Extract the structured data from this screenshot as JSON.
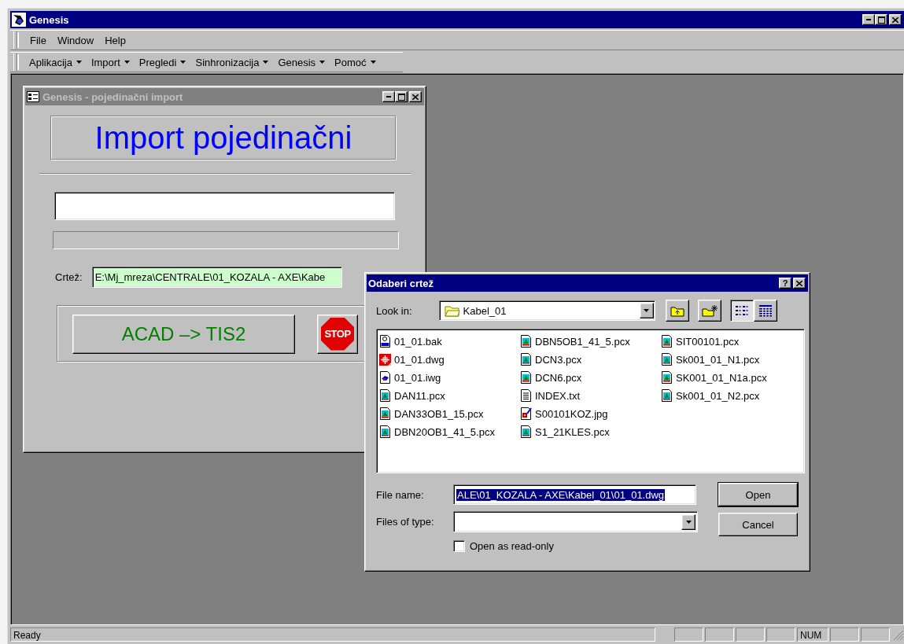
{
  "window": {
    "title": "Genesis",
    "active": true
  },
  "menu": [
    {
      "label": "File"
    },
    {
      "label": "Window"
    },
    {
      "label": "Help"
    }
  ],
  "toolbar": [
    {
      "label": "Aplikacija"
    },
    {
      "label": "Import"
    },
    {
      "label": "Pregledi"
    },
    {
      "label": "Sinhronizacija"
    },
    {
      "label": "Genesis"
    },
    {
      "label": "Pomoć"
    }
  ],
  "import_window": {
    "title": "Genesis - pojedinačni import",
    "active": false,
    "heading": "Import pojedinačni",
    "progress": {
      "level": 0
    },
    "drawing_label": "Crtež:",
    "drawing_path": "E:\\Mj_mreza\\CENTRALE\\01_KOZALA - AXE\\Kabe",
    "convert_button": "ACAD –> TIS2",
    "stop_button": "STOP"
  },
  "dialog": {
    "title": "Odaberi crtež",
    "active": true,
    "help_button": "?",
    "look_in_label": "Look in:",
    "folder": "Kabel_01",
    "view_buttons": [
      {
        "kind": "list",
        "selected": true
      },
      {
        "kind": "details",
        "selected": false
      }
    ],
    "files": [
      {
        "name": "01_01.bak",
        "kind": "bak"
      },
      {
        "name": "01_01.dwg",
        "kind": "dwg"
      },
      {
        "name": "01_01.iwg",
        "kind": "iwg"
      },
      {
        "name": "DAN11.pcx",
        "kind": "pcx"
      },
      {
        "name": "DAN33OB1_15.pcx",
        "kind": "pcx"
      },
      {
        "name": "DBN20OB1_41_5.pcx",
        "kind": "pcx"
      },
      {
        "name": "DBN5OB1_41_5.pcx",
        "kind": "pcx"
      },
      {
        "name": "DCN3.pcx",
        "kind": "pcx"
      },
      {
        "name": "DCN6.pcx",
        "kind": "pcx"
      },
      {
        "name": "INDEX.txt",
        "kind": "txt"
      },
      {
        "name": "S00101KOZ.jpg",
        "kind": "jpg"
      },
      {
        "name": "S1_21KLES.pcx",
        "kind": "pcx"
      },
      {
        "name": "SIT00101.pcx",
        "kind": "pcx"
      },
      {
        "name": "Sk001_01_N1.pcx",
        "kind": "pcx"
      },
      {
        "name": "SK001_01_N1a.pcx",
        "kind": "pcx"
      },
      {
        "name": "Sk001_01_N2.pcx",
        "kind": "pcx"
      }
    ],
    "file_name_label": "File name:",
    "file_name": "ALE\\01_KOZALA - AXE\\Kabel_01\\01_01.dwg",
    "file_name_selected": true,
    "files_of_type_label": "Files of type:",
    "open_button": "Open",
    "cancel_button": "Cancel",
    "read_only": {
      "label": "Open as read-only",
      "checked": false
    }
  },
  "status_bar": {
    "text": "Ready",
    "indicators": [
      {
        "label": "NUM"
      }
    ]
  }
}
